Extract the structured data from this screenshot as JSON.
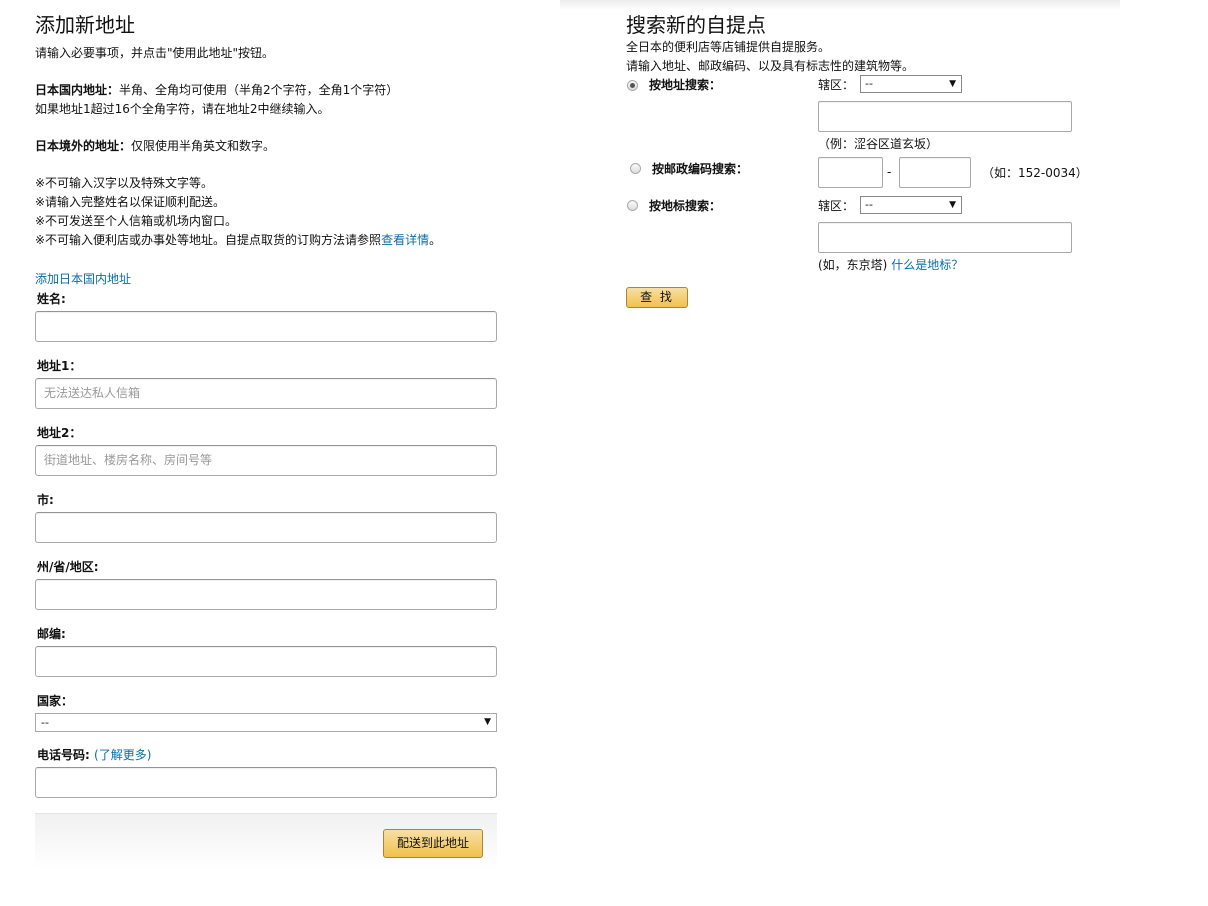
{
  "left": {
    "title": "添加新地址",
    "intro": "请输入必要事项，并点击\"使用此地址\"按钮。",
    "domestic_label": "日本国内地址：",
    "domestic_text": "半角、全角均可使用（半角2个字符，全角1个字符）",
    "domestic_text2": "如果地址1超过16个全角字符，请在地址2中继续输入。",
    "overseas_label": "日本境外的地址：",
    "overseas_text": "仅限使用半角英文和数字。",
    "notes": [
      "※不可输入汉字以及特殊文字等。",
      "※请输入完整姓名以保证顺利配送。",
      "※不可发送至个人信箱或机场内窗口。",
      "※不可输入便利店或办事处等地址。自提点取货的订购方法请参照"
    ],
    "notes_link": "查看详情",
    "notes_tail": "。",
    "add_domestic_link": "添加日本国内地址",
    "fields": {
      "name_label": "姓名:",
      "name_value": "",
      "address1_label": "地址1：",
      "address1_placeholder": "无法送达私人信箱",
      "address2_label": "地址2：",
      "address2_placeholder": "街道地址、楼房名称、房间号等",
      "city_label": "市:",
      "state_label": "州/省/地区:",
      "zip_label": "邮编:",
      "country_label": "国家：",
      "country_value": "--",
      "phone_label": "电话号码:",
      "phone_link_open": "(",
      "phone_link": "了解更多",
      "phone_link_close": ")"
    },
    "submit_button": "配送到此地址"
  },
  "right": {
    "title": "搜索新的自提点",
    "desc1": "全日本的便利店等店铺提供自提服务。",
    "desc2": "请输入地址、邮政编码、以及具有标志性的建筑物等。",
    "by_address_label": "按地址搜索：",
    "district_label": "辖区：",
    "district_value": "--",
    "address_example": "（例：涩谷区道玄坂）",
    "by_zip_label": "按邮政编码搜索：",
    "zip_dash": "-",
    "zip_example": "（如：152-0034）",
    "by_landmark_label": "按地标搜索：",
    "district2_label": "辖区：",
    "district2_value": "--",
    "landmark_example": "(如，东京塔)",
    "landmark_link": "什么是地标？",
    "find_button": "查 找"
  }
}
